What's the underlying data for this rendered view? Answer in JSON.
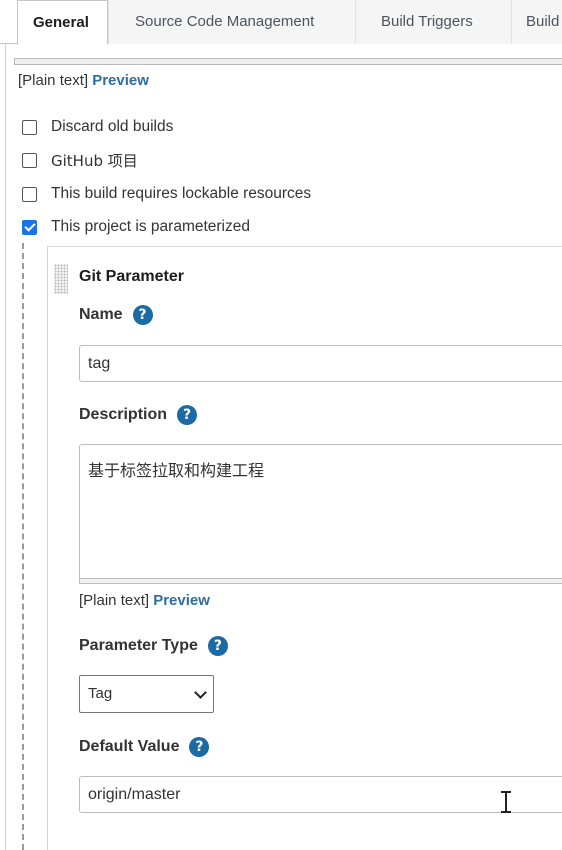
{
  "tabs": [
    {
      "label": "General",
      "active": true
    },
    {
      "label": "Source Code Management",
      "active": false
    },
    {
      "label": "Build Triggers",
      "active": false
    },
    {
      "label": "Build",
      "active": false
    }
  ],
  "top_preview": {
    "plain": "[Plain text]",
    "link": "Preview"
  },
  "options": [
    {
      "label": "Discard old builds",
      "checked": false
    },
    {
      "label": "GitHub 项目",
      "checked": false
    },
    {
      "label": "This build requires lockable resources",
      "checked": false
    },
    {
      "label": "This project is parameterized",
      "checked": true
    }
  ],
  "parameter": {
    "title": "Git Parameter",
    "name_label": "Name",
    "name_value": "tag",
    "description_label": "Description",
    "description_value": "基于标签拉取和构建工程",
    "preview": {
      "plain": "[Plain text]",
      "link": "Preview"
    },
    "type_label": "Parameter Type",
    "type_value": "Tag",
    "default_label": "Default Value",
    "default_value": "origin/master"
  },
  "help_glyph": "?",
  "colors": {
    "accent": "#1a73e8",
    "link": "#2e6da4",
    "help": "#1c6aa3"
  }
}
